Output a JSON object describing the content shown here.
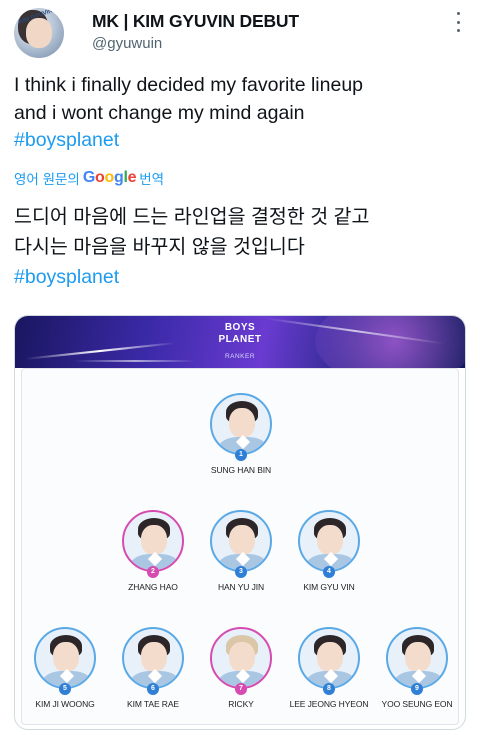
{
  "tweet": {
    "display_name": "MK | KIM GYUVIN DEBUT",
    "handle": "@gyuwuin",
    "avatar_tag": "KIM GYUVIN",
    "text_lines": [
      "I think i finally decided my favorite lineup",
      "and i wont change my mind again"
    ],
    "hashtag": "#boysplanet",
    "translate": {
      "prefix": "영어 원문의",
      "brand": [
        "G",
        "o",
        "o",
        "g",
        "l",
        "e"
      ],
      "suffix": "번역"
    },
    "translation_lines": [
      "드디어 마음에 드는 라인업을 결정한 것 같고",
      "다시는 마음을 바꾸지 않을 것입니다"
    ],
    "translation_hashtag": "#boysplanet"
  },
  "card": {
    "logo_line1": "BOYS",
    "logo_line2": "PLANET",
    "logo_sub": "RANKER",
    "ranking": [
      {
        "rank": "1",
        "name": "SUNG HAN BIN",
        "frame": "blue"
      },
      {
        "rank": "2",
        "name": "ZHANG HAO",
        "frame": "pink"
      },
      {
        "rank": "3",
        "name": "HAN YU JIN",
        "frame": "blue"
      },
      {
        "rank": "4",
        "name": "KIM GYU VIN",
        "frame": "blue"
      },
      {
        "rank": "5",
        "name": "KIM JI WOONG",
        "frame": "blue"
      },
      {
        "rank": "6",
        "name": "KIM TAE RAE",
        "frame": "blue"
      },
      {
        "rank": "7",
        "name": "RICKY",
        "frame": "pink"
      },
      {
        "rank": "8",
        "name": "LEE JEONG HYEON",
        "frame": "blue"
      },
      {
        "rank": "9",
        "name": "YOO SEUNG EON",
        "frame": "blue"
      }
    ]
  },
  "colors": {
    "link": "#1d9bf0",
    "text": "#0f1419",
    "muted": "#536471",
    "frame_blue": "#5aa9e6",
    "frame_pink": "#d54bb0"
  },
  "icons": [
    "more-options-icon",
    "rank-badge-icon"
  ]
}
